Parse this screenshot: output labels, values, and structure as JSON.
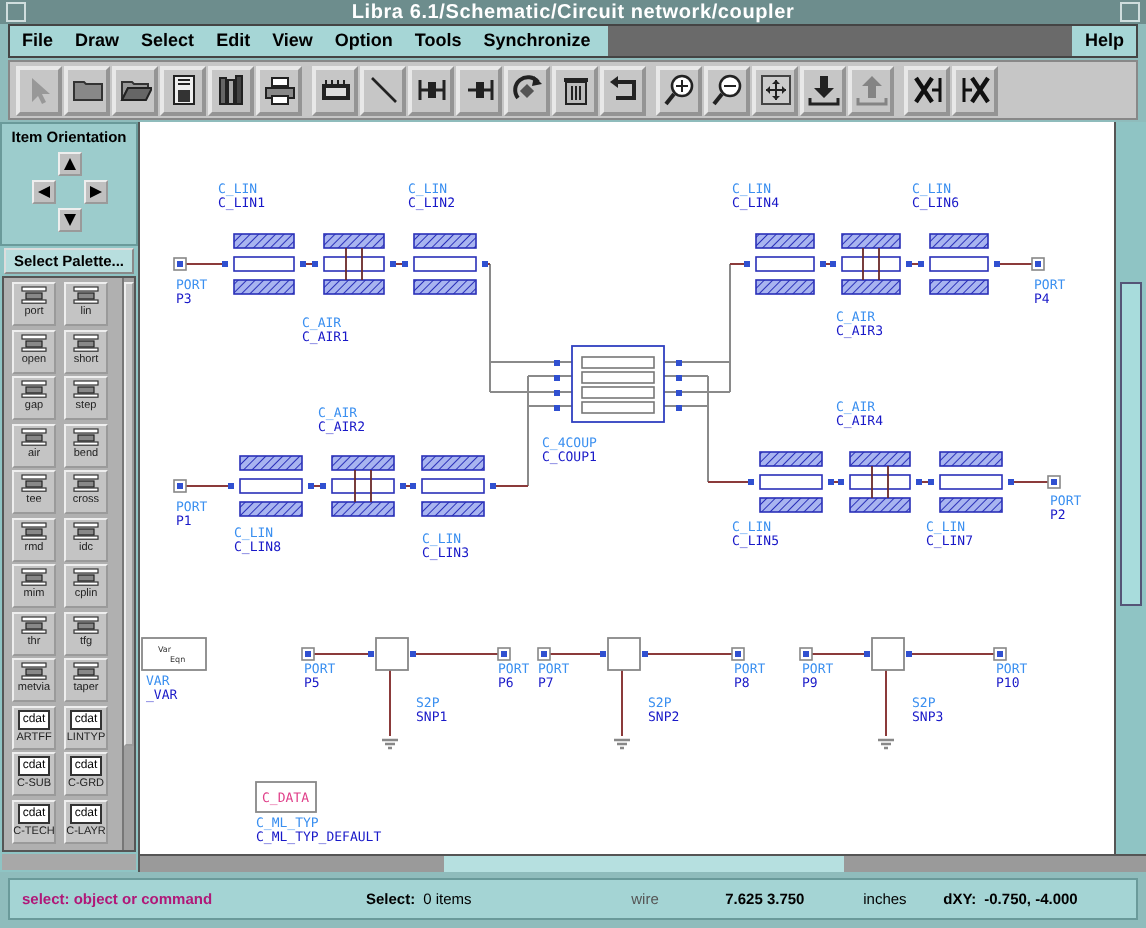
{
  "window": {
    "title": "Libra 6.1/Schematic/Circuit network/coupler"
  },
  "menu": [
    "File",
    "Draw",
    "Select",
    "Edit",
    "View",
    "Option",
    "Tools",
    "Synchronize"
  ],
  "help_menu": "Help",
  "toolbar": [
    [
      {
        "kind": "select",
        "disabled": true
      },
      {
        "kind": "folder",
        "disabled": false
      },
      {
        "kind": "open",
        "disabled": false
      },
      {
        "kind": "save",
        "disabled": false
      },
      {
        "kind": "library",
        "disabled": false
      },
      {
        "kind": "print",
        "disabled": false
      }
    ],
    [
      {
        "kind": "component",
        "disabled": false
      },
      {
        "kind": "line",
        "disabled": false
      },
      {
        "kind": "connect",
        "disabled": false
      },
      {
        "kind": "disconnect",
        "disabled": false
      },
      {
        "kind": "rotate",
        "disabled": false
      },
      {
        "kind": "delete",
        "disabled": false
      },
      {
        "kind": "undo",
        "disabled": false
      }
    ],
    [
      {
        "kind": "zoom-in",
        "disabled": false
      },
      {
        "kind": "zoom-out",
        "disabled": false
      },
      {
        "kind": "fit",
        "disabled": false
      },
      {
        "kind": "download",
        "disabled": false
      },
      {
        "kind": "upload",
        "disabled": true
      }
    ],
    [
      {
        "kind": "split",
        "disabled": false
      },
      {
        "kind": "join",
        "disabled": false
      }
    ]
  ],
  "item_orientation": {
    "title": "Item Orientation"
  },
  "palette_button": "Select Palette...",
  "palette": [
    {
      "kind": "component",
      "label": "port"
    },
    {
      "kind": "component",
      "label": "lin"
    },
    {
      "kind": "component",
      "label": "open"
    },
    {
      "kind": "component",
      "label": "short"
    },
    {
      "kind": "component",
      "label": "gap"
    },
    {
      "kind": "component",
      "label": "step"
    },
    {
      "kind": "component",
      "label": "air"
    },
    {
      "kind": "component",
      "label": "bend"
    },
    {
      "kind": "component",
      "label": "tee"
    },
    {
      "kind": "component",
      "label": "cross"
    },
    {
      "kind": "component",
      "label": "rmd"
    },
    {
      "kind": "component",
      "label": "idc"
    },
    {
      "kind": "component",
      "label": "mim"
    },
    {
      "kind": "component",
      "label": "cplin"
    },
    {
      "kind": "component",
      "label": "thr"
    },
    {
      "kind": "component",
      "label": "tfg"
    },
    {
      "kind": "component",
      "label": "metvia"
    },
    {
      "kind": "component",
      "label": "taper"
    },
    {
      "kind": "data",
      "badge": "cdat",
      "label": "ARTFF"
    },
    {
      "kind": "data",
      "badge": "cdat",
      "label": "LINTYP"
    },
    {
      "kind": "data",
      "badge": "cdat",
      "label": "C-SUB"
    },
    {
      "kind": "data",
      "badge": "cdat",
      "label": "C-GRD"
    },
    {
      "kind": "data",
      "badge": "cdat",
      "label": "C-TECH"
    },
    {
      "kind": "data",
      "badge": "cdat",
      "label": "C-LAYR"
    }
  ],
  "schematic": {
    "labels": [
      {
        "type": "C_LIN",
        "name": "C_LIN1"
      },
      {
        "type": "C_LIN",
        "name": "C_LIN2"
      },
      {
        "type": "C_LIN",
        "name": "C_LIN4"
      },
      {
        "type": "C_LIN",
        "name": "C_LIN6"
      },
      {
        "type": "PORT",
        "name": "P3"
      },
      {
        "type": "PORT",
        "name": "P4"
      },
      {
        "type": "C_AIR",
        "name": "C_AIR1"
      },
      {
        "type": "C_AIR",
        "name": "C_AIR3"
      },
      {
        "type": "C_AIR",
        "name": "C_AIR2"
      },
      {
        "type": "C_4COUP",
        "name": "C_COUP1"
      },
      {
        "type": "C_AIR",
        "name": "C_AIR4"
      },
      {
        "type": "PORT",
        "name": "P1"
      },
      {
        "type": "PORT",
        "name": "P2"
      },
      {
        "type": "C_LIN",
        "name": "C_LIN8"
      },
      {
        "type": "C_LIN",
        "name": "C_LIN3"
      },
      {
        "type": "C_LIN",
        "name": "C_LIN5"
      },
      {
        "type": "C_LIN",
        "name": "C_LIN7"
      },
      {
        "type": "PORT",
        "name": "P5"
      },
      {
        "type": "PORT",
        "name": "P6"
      },
      {
        "type": "PORT",
        "name": "P7"
      },
      {
        "type": "PORT",
        "name": "P8"
      },
      {
        "type": "PORT",
        "name": "P9"
      },
      {
        "type": "PORT",
        "name": "P10"
      },
      {
        "type": "S2P",
        "name": "SNP1"
      },
      {
        "type": "S2P",
        "name": "SNP2"
      },
      {
        "type": "S2P",
        "name": "SNP3"
      },
      {
        "type": "VAR",
        "name": "_VAR"
      },
      {
        "type": "C_ML_TYP",
        "name": "C_ML_TYP_DEFAULT"
      }
    ],
    "var_box": [
      "Var",
      "Eqn"
    ],
    "data_box": "C_DATA"
  },
  "status_bar": {
    "message": "select: object or command",
    "select_label": "Select:",
    "select_count": "0 items",
    "mode": "wire",
    "coords": "7.625 3.750",
    "units": "inches",
    "delta_label": "dXY:",
    "delta": "-0.750, -4.000"
  }
}
